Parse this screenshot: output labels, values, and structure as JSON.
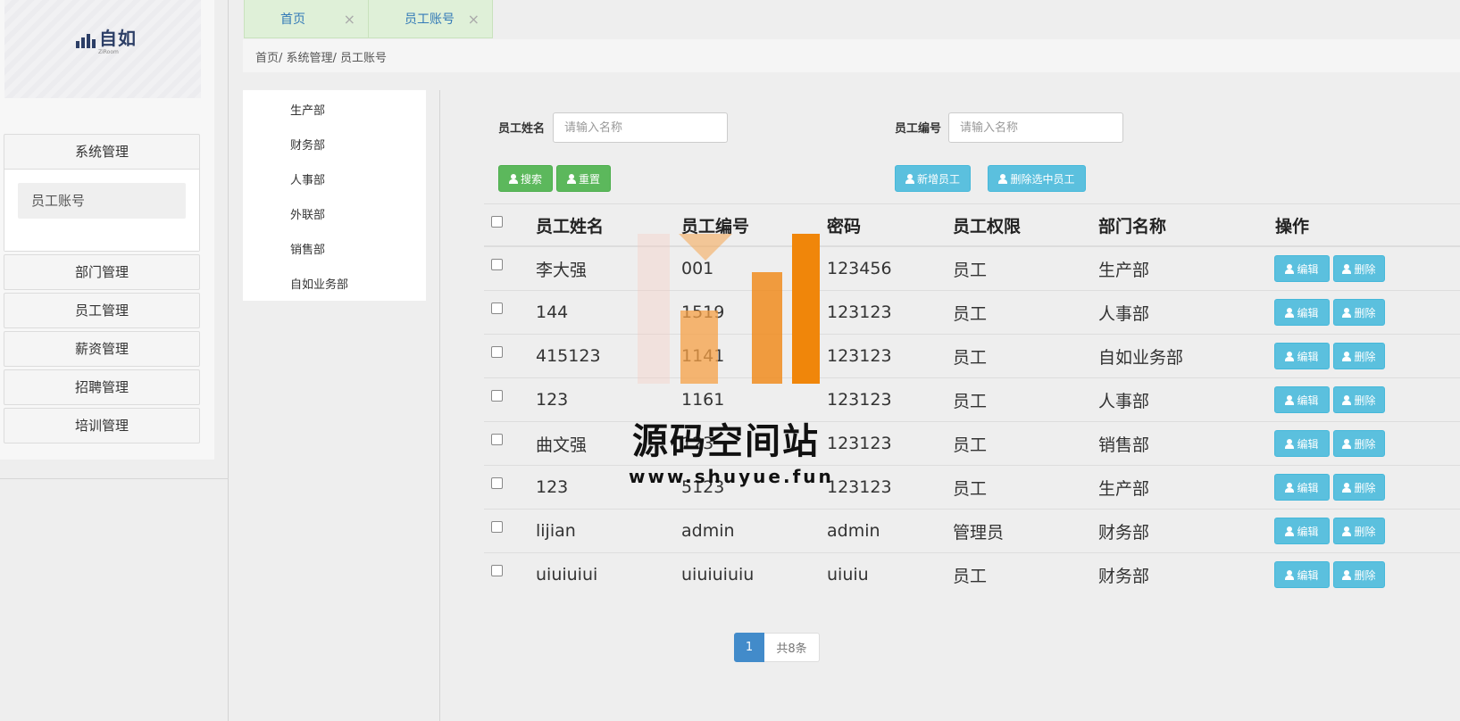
{
  "logo": {
    "text": "自如",
    "subtext": "ZiRoom"
  },
  "sidebar": {
    "open_group": {
      "label": "系统管理",
      "items": [
        {
          "label": "员工账号"
        }
      ]
    },
    "groups": [
      {
        "label": "部门管理"
      },
      {
        "label": "员工管理"
      },
      {
        "label": "薪资管理"
      },
      {
        "label": "招聘管理"
      },
      {
        "label": "培训管理"
      }
    ]
  },
  "tabs": [
    {
      "label": "首页",
      "close": "×"
    },
    {
      "label": "员工账号",
      "close": "×"
    }
  ],
  "breadcrumb": "首页/ 系统管理/ 员工账号",
  "departments": [
    "生产部",
    "财务部",
    "人事部",
    "外联部",
    "销售部",
    "自如业务部"
  ],
  "search": {
    "name_label": "员工姓名",
    "name_placeholder": "请输入名称",
    "id_label": "员工编号",
    "id_placeholder": "请输入名称",
    "search_btn": "搜索",
    "reset_btn": "重置",
    "add_btn": "新增员工",
    "delete_selected_btn": "删除选中员工"
  },
  "table": {
    "headers": [
      "员工姓名",
      "员工编号",
      "密码",
      "员工权限",
      "部门名称",
      "操作"
    ],
    "edit_label": "编辑",
    "delete_label": "删除",
    "rows": [
      {
        "name": "李大强",
        "id": "001",
        "password": "123456",
        "role": "员工",
        "dept": "生产部"
      },
      {
        "name": "144",
        "id": "1519",
        "password": "123123",
        "role": "员工",
        "dept": "人事部"
      },
      {
        "name": "415123",
        "id": "1141",
        "password": "123123",
        "role": "员工",
        "dept": "自如业务部"
      },
      {
        "name": "123",
        "id": "1161",
        "password": "123123",
        "role": "员工",
        "dept": "人事部"
      },
      {
        "name": "曲文强",
        "id": "123",
        "password": "123123",
        "role": "员工",
        "dept": "销售部"
      },
      {
        "name": "123",
        "id": "5123",
        "password": "123123",
        "role": "员工",
        "dept": "生产部"
      },
      {
        "name": "lijian",
        "id": "admin",
        "password": "admin",
        "role": "管理员",
        "dept": "财务部"
      },
      {
        "name": "uiuiuiui",
        "id": "uiuiuiuiu",
        "password": "uiuiu",
        "role": "员工",
        "dept": "财务部"
      }
    ]
  },
  "pagination": {
    "current": "1",
    "total": "共8条"
  },
  "watermark": {
    "text": "源码空间站",
    "url": "www.shuyue.fun"
  },
  "colors": {
    "tab_bg": "#dff0d8",
    "btn_green": "#5cb85c",
    "btn_info": "#5bc0de",
    "page_active": "#428bca",
    "watermark_orange": "#f0860a"
  }
}
